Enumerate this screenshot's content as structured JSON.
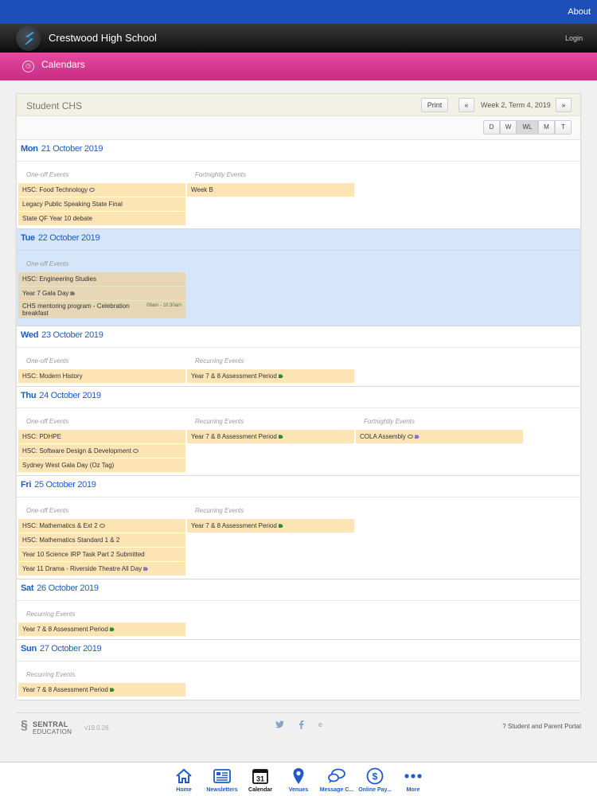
{
  "topbar": {
    "about": "About"
  },
  "header": {
    "school_name": "Crestwood High School",
    "login": "Login"
  },
  "section": {
    "title": "Calendars"
  },
  "calendar": {
    "name": "Student CHS",
    "print": "Print",
    "prev": "«",
    "next": "»",
    "week_label": "Week 2, Term 4, 2019",
    "views": [
      "D",
      "W",
      "WL",
      "M",
      "T"
    ],
    "active_view": "WL"
  },
  "days": [
    {
      "dow": "Mon",
      "date": "21 October 2019",
      "columns": [
        {
          "title": "One-off Events",
          "events": [
            {
              "label": "HSC: Food Technology",
              "marks": [
                "bubble"
              ]
            },
            {
              "label": "Legacy Public Speaking State Final"
            },
            {
              "label": "State QF Year 10 debate"
            }
          ]
        },
        {
          "title": "Fortnightly Events",
          "events": [
            {
              "label": "Week B"
            }
          ]
        }
      ]
    },
    {
      "dow": "Tue",
      "date": "22 October 2019",
      "today": true,
      "columns": [
        {
          "title": "One-off Events",
          "events": [
            {
              "label": "HSC: Engineering Studies"
            },
            {
              "label": "Year 7 Gala Day",
              "marks": [
                "gray"
              ]
            },
            {
              "label": "CHS mentoring program - Celebration breakfast",
              "time": "09am - 10:30am"
            }
          ]
        }
      ]
    },
    {
      "dow": "Wed",
      "date": "23 October 2019",
      "columns": [
        {
          "title": "One-off Events",
          "events": [
            {
              "label": "HSC: Modern History"
            }
          ]
        },
        {
          "title": "Recurring Events",
          "events": [
            {
              "label": "Year 7 & 8 Assessment Period",
              "marks": [
                "green"
              ]
            }
          ]
        }
      ]
    },
    {
      "dow": "Thu",
      "date": "24 October 2019",
      "columns": [
        {
          "title": "One-off Events",
          "events": [
            {
              "label": "HSC: PDHPE"
            },
            {
              "label": "HSC: Software Design & Development",
              "marks": [
                "bubble"
              ]
            },
            {
              "label": "Sydney West Gala Day (Oz Tag)"
            }
          ]
        },
        {
          "title": "Recurring Events",
          "events": [
            {
              "label": "Year 7 & 8 Assessment Period",
              "marks": [
                "green"
              ]
            }
          ]
        },
        {
          "title": "Fortnightly Events",
          "events": [
            {
              "label": "COLA Assembly",
              "marks": [
                "bubble",
                "purple"
              ]
            }
          ]
        }
      ]
    },
    {
      "dow": "Fri",
      "date": "25 October 2019",
      "columns": [
        {
          "title": "One-off Events",
          "events": [
            {
              "label": "HSC: Mathematics & Ext 2",
              "marks": [
                "bubble"
              ]
            },
            {
              "label": "HSC: Mathematics Standard 1 & 2"
            },
            {
              "label": "Year 10 Science IRP Task Part 2 Submitted"
            },
            {
              "label": "Year 11 Drama - Riverside Theatre All Day",
              "marks": [
                "purple"
              ]
            }
          ]
        },
        {
          "title": "Recurring Events",
          "events": [
            {
              "label": "Year 7 & 8 Assessment Period",
              "marks": [
                "green"
              ]
            }
          ]
        }
      ]
    },
    {
      "dow": "Sat",
      "date": "26 October 2019",
      "columns": [
        {
          "title": "Recurring Events",
          "events": [
            {
              "label": "Year 7 & 8 Assessment Period",
              "marks": [
                "green"
              ]
            }
          ]
        }
      ]
    },
    {
      "dow": "Sun",
      "date": "27 October 2019",
      "columns": [
        {
          "title": "Recurring Events",
          "events": [
            {
              "label": "Year 7 & 8 Assessment Period",
              "marks": [
                "green"
              ]
            }
          ]
        }
      ]
    }
  ],
  "footer": {
    "brand_top": "SENTRAL",
    "brand_bottom": "EDUCATION",
    "version": "v19.0.26",
    "portal": "? Student and Parent Portal"
  },
  "tabs": [
    {
      "label": "Home",
      "icon": "home-icon"
    },
    {
      "label": "Newsletters",
      "icon": "newsletter-icon"
    },
    {
      "label": "Calendar",
      "icon": "calendar-icon",
      "active": true,
      "day": "31"
    },
    {
      "label": "Venues",
      "icon": "location-pin-icon"
    },
    {
      "label": "Message C...",
      "icon": "chat-icon"
    },
    {
      "label": "Online Pay...",
      "icon": "dollar-icon"
    },
    {
      "label": "More",
      "icon": "more-dots-icon"
    }
  ],
  "colors": {
    "top_bar": "#1e4fb8",
    "section_bar": "#d23a91",
    "event_bg": "#fde4b5",
    "today_bg": "#d5e6fb",
    "date_text": "#1e5bc6"
  }
}
